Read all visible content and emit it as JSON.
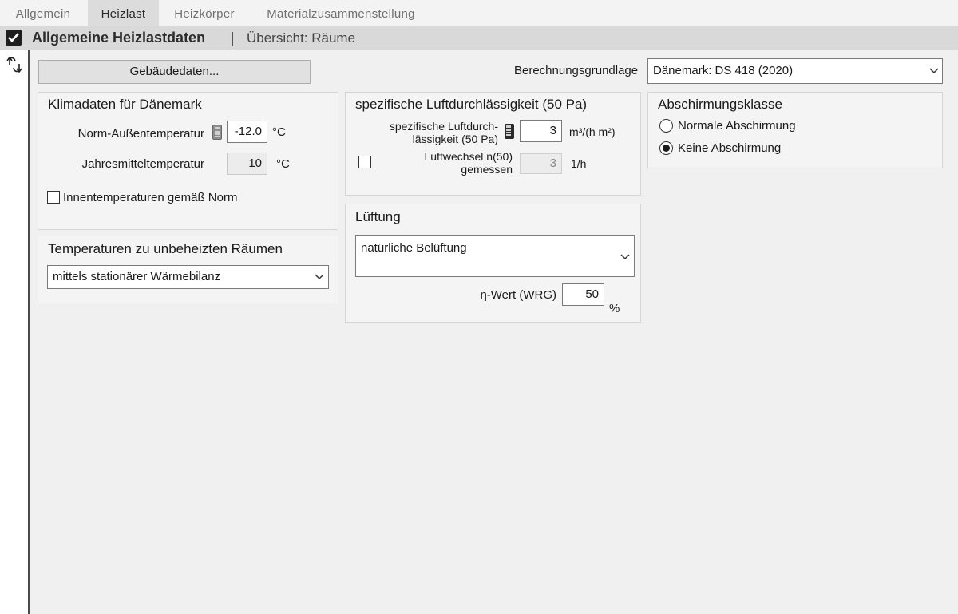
{
  "tabs": [
    {
      "label": "Allgemein",
      "active": false
    },
    {
      "label": "Heizlast",
      "active": true
    },
    {
      "label": "Heizkörper",
      "active": false
    },
    {
      "label": "Materialzusammenstellung",
      "active": false
    }
  ],
  "header": {
    "checked": true,
    "title": "Allgemeine Heizlastdaten",
    "subtitle": "Übersicht: Räume"
  },
  "toolbar": {
    "gebaeude_button": "Gebäudedaten...",
    "berechnung_label": "Berechnungsgrundlage",
    "berechnung_value": "Dänemark: DS 418 (2020)"
  },
  "klima": {
    "title": "Klimadaten für Dänemark",
    "norm_label": "Norm-Außentemperatur",
    "norm_value": "-12.0",
    "norm_unit": "°C",
    "jahres_label": "Jahresmitteltemperatur",
    "jahres_value": "10",
    "jahres_unit": "°C",
    "innen_label": "Innentemperaturen gemäß Norm",
    "innen_checked": false
  },
  "unbeheizt": {
    "title": "Temperaturen zu unbeheizten Räumen",
    "select_value": "mittels stationärer Wärmebilanz"
  },
  "luft": {
    "title": "spezifische Luftdurchlässigkeit (50 Pa)",
    "spez_label_1": "spezifische Luftdurch-",
    "spez_label_2": "lässigkeit (50 Pa)",
    "spez_value": "3",
    "spez_unit": "m³/(h m²)",
    "wechsel_label_1": "Luftwechsel n(50)",
    "wechsel_label_2": "gemessen",
    "wechsel_value": "3",
    "wechsel_unit": "1/h",
    "wechsel_checked": false
  },
  "lueftung": {
    "title": "Lüftung",
    "select_value": "natürliche Belüftung",
    "eta_label": "η-Wert (WRG)",
    "eta_value": "50",
    "eta_unit": "%"
  },
  "abschirmung": {
    "title": "Abschirmungsklasse",
    "options": [
      {
        "label": "Normale Abschirmung",
        "selected": false
      },
      {
        "label": "Keine Abschirmung",
        "selected": true
      }
    ]
  },
  "colors": {
    "background": "#f0f0f0",
    "tab_active": "#dcdcdc",
    "section_bar": "#d9d9d9",
    "group_background": "#f4f4f4"
  }
}
